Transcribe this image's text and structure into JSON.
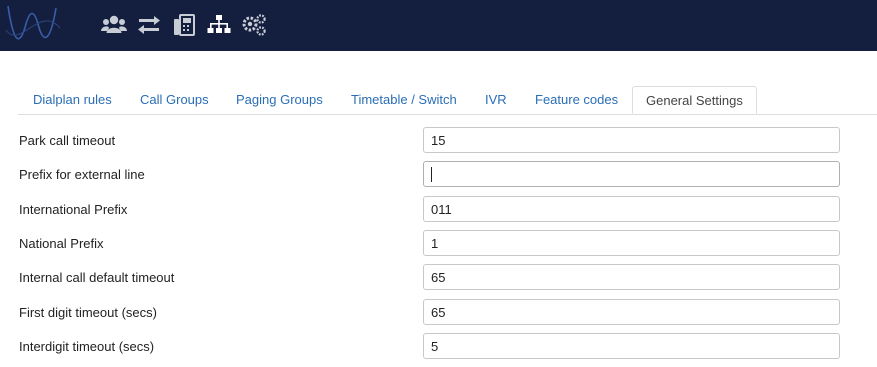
{
  "header": {
    "icons": [
      {
        "name": "users-icon"
      },
      {
        "name": "transfer-arrows-icon"
      },
      {
        "name": "fax-icon"
      },
      {
        "name": "sitemap-icon"
      },
      {
        "name": "gears-icon"
      }
    ]
  },
  "tabs": [
    {
      "label": "Dialplan rules",
      "active": false
    },
    {
      "label": "Call Groups",
      "active": false
    },
    {
      "label": "Paging Groups",
      "active": false
    },
    {
      "label": "Timetable / Switch",
      "active": false
    },
    {
      "label": "IVR",
      "active": false
    },
    {
      "label": "Feature codes",
      "active": false
    },
    {
      "label": "General Settings",
      "active": true
    }
  ],
  "settings": [
    {
      "label": "Park call timeout",
      "value": "15"
    },
    {
      "label": "Prefix for external line",
      "value": ""
    },
    {
      "label": "International Prefix",
      "value": "011"
    },
    {
      "label": "National Prefix",
      "value": "1"
    },
    {
      "label": "Internal call default timeout",
      "value": "65"
    },
    {
      "label": "First digit timeout (secs)",
      "value": "65"
    },
    {
      "label": "Interdigit timeout (secs)",
      "value": "5"
    }
  ],
  "colors": {
    "topbar": "#141f3f",
    "icon": "#c8ccd4",
    "link": "#2a6eb5"
  }
}
